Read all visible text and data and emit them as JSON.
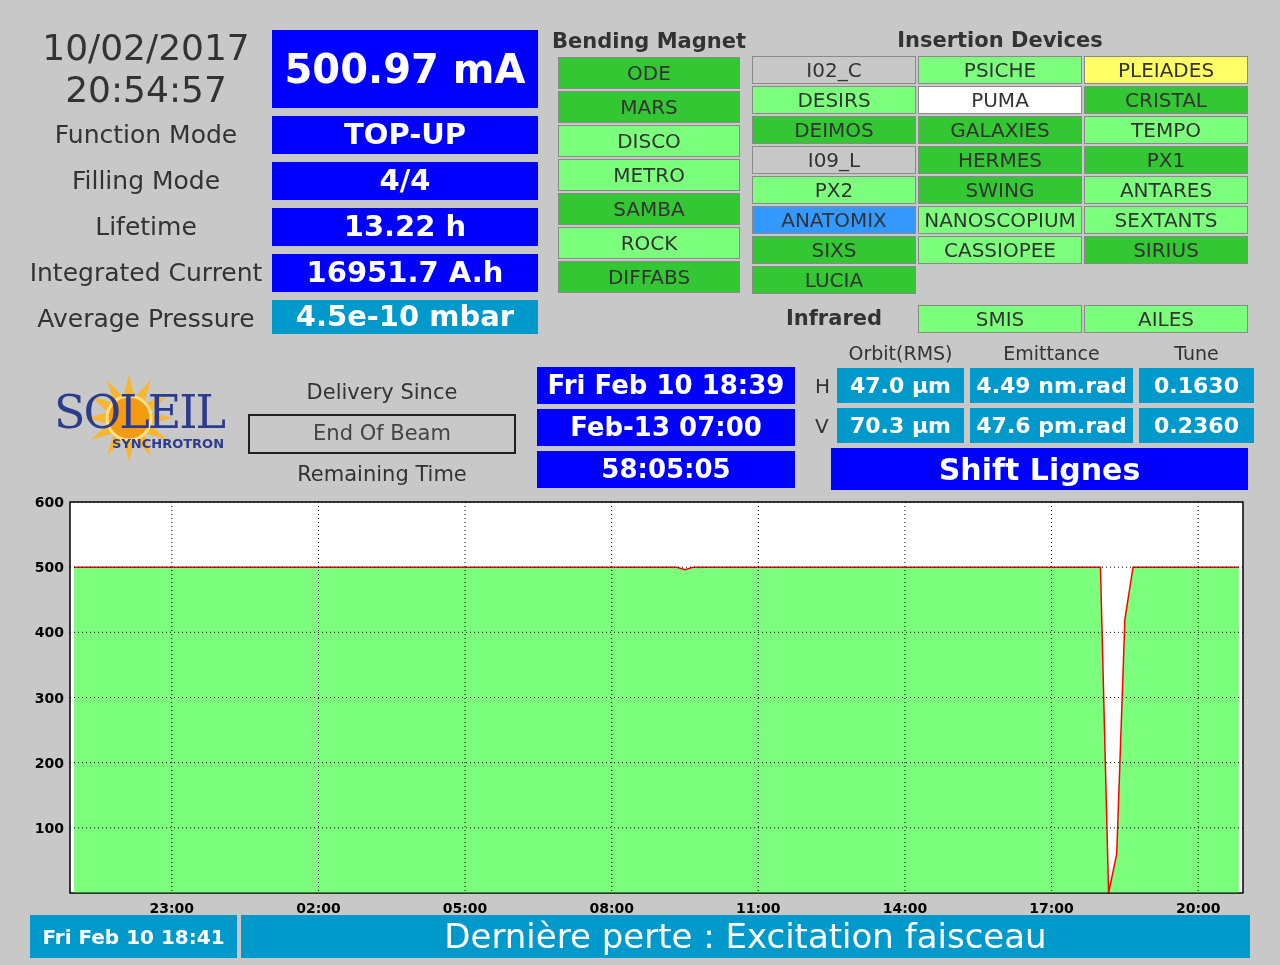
{
  "datetime": {
    "date": "10/02/2017",
    "time": "20:54:57"
  },
  "current": "500.97 mA",
  "parameters": [
    {
      "label": "Function Mode",
      "value": "TOP-UP",
      "kind": "primary"
    },
    {
      "label": "Filling Mode",
      "value": "4/4",
      "kind": "primary"
    },
    {
      "label": "Lifetime",
      "value": "13.22 h",
      "kind": "primary"
    },
    {
      "label": "Integrated Current",
      "value": "16951.7 A.h",
      "kind": "primary"
    },
    {
      "label": "Average Pressure",
      "value": "4.5e-10 mbar",
      "kind": "secondary"
    }
  ],
  "bending_magnet": {
    "title": "Bending Magnet",
    "beamlines": [
      {
        "name": "ODE",
        "color": "#33c733"
      },
      {
        "name": "MARS",
        "color": "#33c733"
      },
      {
        "name": "DISCO",
        "color": "#7cff7c"
      },
      {
        "name": "METRO",
        "color": "#7cff7c"
      },
      {
        "name": "SAMBA",
        "color": "#33c733"
      },
      {
        "name": "ROCK",
        "color": "#7cff7c"
      },
      {
        "name": "DIFFABS",
        "color": "#33c733"
      }
    ]
  },
  "insertion_devices": {
    "title": "Insertion Devices",
    "beamlines": [
      {
        "name": "I02_C",
        "color": "#c8c8c8"
      },
      {
        "name": "PSICHE",
        "color": "#7cff7c"
      },
      {
        "name": "PLEIADES",
        "color": "#ffff66"
      },
      {
        "name": "DESIRS",
        "color": "#7cff7c"
      },
      {
        "name": "PUMA",
        "color": "#ffffff"
      },
      {
        "name": "CRISTAL",
        "color": "#33c733"
      },
      {
        "name": "DEIMOS",
        "color": "#33c733"
      },
      {
        "name": "GALAXIES",
        "color": "#33c733"
      },
      {
        "name": "TEMPO",
        "color": "#7cff7c"
      },
      {
        "name": "I09_L",
        "color": "#c8c8c8"
      },
      {
        "name": "HERMES",
        "color": "#33c733"
      },
      {
        "name": "PX1",
        "color": "#33c733"
      },
      {
        "name": "PX2",
        "color": "#7cff7c"
      },
      {
        "name": "SWING",
        "color": "#33c733"
      },
      {
        "name": "ANTARES",
        "color": "#7cff7c"
      },
      {
        "name": "ANATOMIX",
        "color": "#3399ff"
      },
      {
        "name": "NANOSCOPIUM",
        "color": "#7cff7c"
      },
      {
        "name": "SEXTANTS",
        "color": "#7cff7c"
      },
      {
        "name": "SIXS",
        "color": "#33c733"
      },
      {
        "name": "CASSIOPEE",
        "color": "#7cff7c"
      },
      {
        "name": "SIRIUS",
        "color": "#33c733"
      },
      {
        "name": "LUCIA",
        "color": "#33c733"
      }
    ]
  },
  "infrared": {
    "label": "Infrared",
    "beamlines": [
      {
        "name": "SMIS",
        "color": "#7cff7c"
      },
      {
        "name": "AILES",
        "color": "#7cff7c"
      }
    ]
  },
  "logo": {
    "name": "SOLEIL",
    "subtitle": "SYNCHROTRON"
  },
  "delivery": [
    {
      "label": "Delivery Since",
      "value": "Fri Feb 10 18:39",
      "kind": "plain"
    },
    {
      "label": "End Of Beam",
      "value": "Feb-13 07:00",
      "kind": "framed"
    },
    {
      "label": "Remaining Time",
      "value": "58:05:05",
      "kind": "plain"
    }
  ],
  "beam_params": {
    "columns": [
      "Orbit(RMS)",
      "Emittance",
      "Tune"
    ],
    "rows": [
      {
        "plane": "H",
        "values": [
          "47.0 µm",
          "4.49 nm.rad",
          "0.1630"
        ]
      },
      {
        "plane": "V",
        "values": [
          "70.3 µm",
          "47.6 pm.rad",
          "0.2360"
        ]
      }
    ]
  },
  "shift": "Shift Lignes",
  "chart": {
    "chart_data": {
      "type": "area",
      "categories": [
        null,
        null,
        null,
        null,
        null,
        null,
        null,
        null,
        null,
        null,
        null,
        null,
        "23:00",
        null,
        null,
        null,
        null,
        null,
        null,
        null,
        null,
        null,
        null,
        null,
        null,
        null,
        null,
        null,
        null,
        null,
        "02:00",
        null,
        null,
        null,
        null,
        null,
        null,
        null,
        null,
        null,
        null,
        null,
        null,
        null,
        null,
        null,
        null,
        null,
        "05:00",
        null,
        null,
        null,
        null,
        null,
        null,
        null,
        null,
        null,
        null,
        null,
        null,
        null,
        null,
        null,
        null,
        null,
        "08:00",
        null,
        null,
        null,
        null,
        null,
        null,
        null,
        null,
        null,
        null,
        null,
        null,
        null,
        null,
        null,
        null,
        null,
        "11:00",
        null,
        null,
        null,
        null,
        null,
        null,
        null,
        null,
        null,
        null,
        null,
        null,
        null,
        null,
        null,
        null,
        null,
        "14:00",
        null,
        null,
        null,
        null,
        null,
        null,
        null,
        null,
        null,
        null,
        null,
        null,
        null,
        null,
        null,
        null,
        null,
        "17:00",
        null,
        null,
        null,
        null,
        null,
        null,
        null,
        null,
        null,
        null,
        null,
        null,
        null,
        null,
        null,
        null,
        null,
        "20:00",
        null,
        null,
        null,
        null,
        null
      ],
      "series": [
        {
          "color": "#7cff7c",
          "values": [
            500,
            500,
            500,
            500,
            500,
            500,
            500,
            500,
            500,
            500,
            500,
            500,
            500,
            500,
            500,
            500,
            500,
            500,
            500,
            500,
            500,
            500,
            500,
            500,
            500,
            500,
            500,
            500,
            500,
            500,
            500,
            500,
            500,
            500,
            500,
            500,
            500,
            500,
            500,
            500,
            500,
            500,
            500,
            500,
            500,
            500,
            500,
            500,
            500,
            500,
            500,
            500,
            500,
            500,
            500,
            500,
            500,
            500,
            500,
            500,
            500,
            500,
            500,
            500,
            500,
            500,
            500,
            500,
            500,
            500,
            500,
            500,
            500,
            500,
            500,
            496,
            500,
            500,
            500,
            500,
            500,
            500,
            500,
            500,
            500,
            500,
            500,
            500,
            500,
            500,
            500,
            500,
            500,
            500,
            500,
            500,
            500,
            500,
            500,
            500,
            500,
            500,
            500,
            500,
            500,
            500,
            500,
            500,
            500,
            500,
            500,
            500,
            500,
            500,
            500,
            500,
            500,
            500,
            500,
            500,
            500,
            500,
            500,
            500,
            500,
            500,
            500,
            0,
            60,
            420,
            500,
            500,
            500,
            500,
            500,
            500,
            500,
            500,
            500,
            500,
            500,
            500,
            500,
            500
          ]
        }
      ],
      "grid": true,
      "ylim": [
        0,
        600
      ],
      "yticks": [
        100,
        200,
        300,
        400,
        500,
        600
      ]
    }
  },
  "status_bar": {
    "timestamp": "Fri Feb 10 18:41",
    "message": "Dernière perte : Excitation faisceau"
  }
}
